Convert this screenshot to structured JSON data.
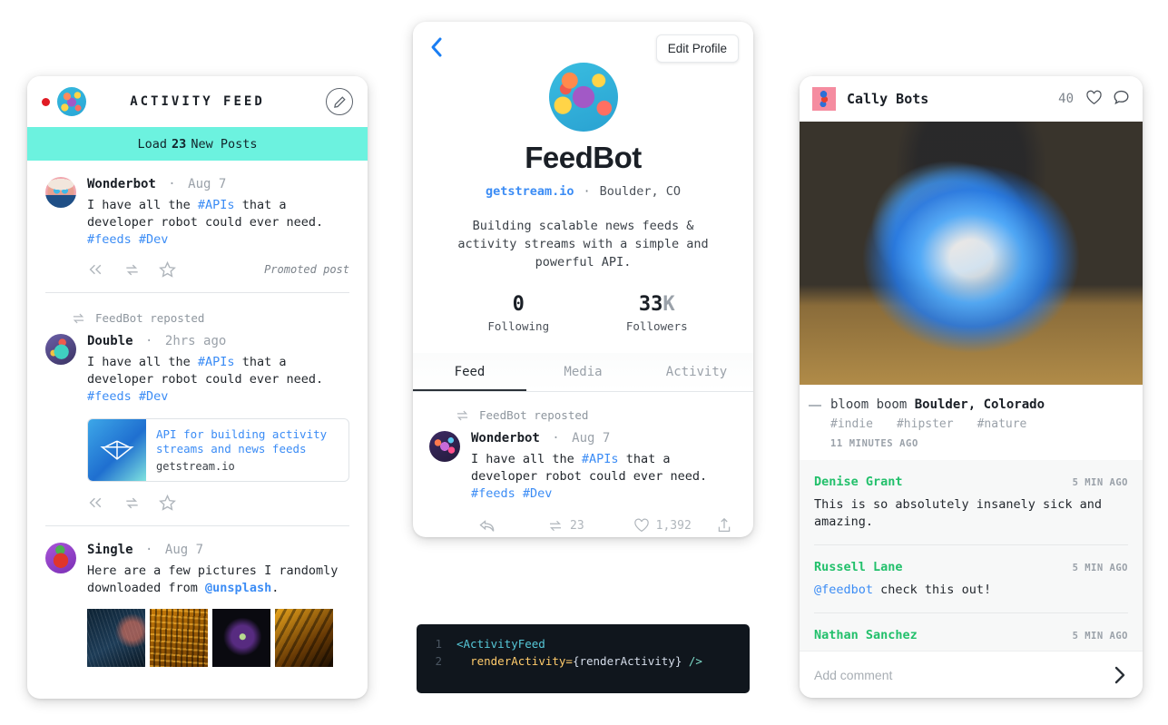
{
  "activity_feed": {
    "title": "ACTIVITY FEED",
    "status_dot": "unread-dot",
    "compose_icon": "pencil-icon",
    "load_more": {
      "prefix": "Load",
      "count": "23",
      "suffix": "New Posts"
    },
    "posts": [
      {
        "author": "Wonderbot",
        "separator": "·",
        "time": "Aug 7",
        "text_before": "I have all the ",
        "tag1": "#APIs",
        "text_middle": " that a developer robot could ever need. ",
        "tag2": "#feeds",
        "tag3": "#Dev",
        "promoted_label": "Promoted post"
      },
      {
        "repost_label": "FeedBot reposted",
        "author": "Double",
        "separator": "·",
        "time": "2hrs ago",
        "text_before": "I have all the ",
        "tag1": "#APIs",
        "text_middle": " that a developer robot could ever need. ",
        "tag2": "#feeds",
        "tag3": "#Dev",
        "link_card": {
          "title": "API for building activity streams and news feeds",
          "host": "getstream.io"
        }
      },
      {
        "author": "Single",
        "separator": "·",
        "time": "Aug 7",
        "text_before": "Here are a few pictures I randomly downloaded from ",
        "mention": "@unsplash",
        "text_after": "."
      }
    ]
  },
  "profile": {
    "back_icon": "chevron-left-icon",
    "edit_button": "Edit Profile",
    "name": "FeedBot",
    "url": "getstream.io",
    "dot": "·",
    "location": "Boulder, CO",
    "bio": "Building scalable news feeds & activity streams with a simple and powerful API.",
    "stats": [
      {
        "value": "0",
        "suffix": "",
        "label": "Following"
      },
      {
        "value": "33",
        "suffix": "K",
        "label": "Followers"
      }
    ],
    "tabs": [
      {
        "label": "Feed",
        "active": true
      },
      {
        "label": "Media",
        "active": false
      },
      {
        "label": "Activity",
        "active": false
      }
    ],
    "post": {
      "repost_label": "FeedBot reposted",
      "author": "Wonderbot",
      "separator": "·",
      "time": "Aug 7",
      "text_before": "I have all the ",
      "tag1": "#APIs",
      "text_middle": " that a developer robot could ever need. ",
      "tag2": "#feeds",
      "tag3": "#Dev",
      "repost_count": "23",
      "like_count": "1,392"
    }
  },
  "code": {
    "line1_number": "1",
    "line1_tag": "<ActivityFeed",
    "line2_number": "2",
    "line2_attr": "renderActivity=",
    "line2_brace": "{renderActivity}",
    "line2_close": "/>"
  },
  "photo": {
    "author": "Cally Bots",
    "like_count": "40",
    "heart_icon": "heart-icon",
    "comment_icon": "comment-icon",
    "image_alt": "blue smoke bomb in graffiti tunnel",
    "caption_plain": "bloom boom ",
    "caption_bold": "Boulder, Colorado",
    "tags": [
      "#indie",
      "#hipster",
      "#nature"
    ],
    "timestamp": "11 MINUTES AGO",
    "comments": [
      {
        "name": "Denise Grant",
        "time": "5 MIN AGO",
        "text": "This is so absolutely insanely sick and amazing."
      },
      {
        "name": "Russell Lane",
        "time": "5 MIN AGO",
        "mention": "@feedbot",
        "text": " check this out!"
      },
      {
        "name": "Nathan Sanchez",
        "time": "5 MIN AGO",
        "text": ""
      }
    ],
    "add_comment_placeholder": "Add comment",
    "send_icon": "chevron-right-icon"
  },
  "colors": {
    "accent_teal": "#6cf2df",
    "link_blue": "#3b8cf5",
    "back_blue": "#1a7ef3",
    "comment_green": "#22c06b",
    "text_dark": "#1a1f26",
    "muted": "#9aa1a9"
  }
}
